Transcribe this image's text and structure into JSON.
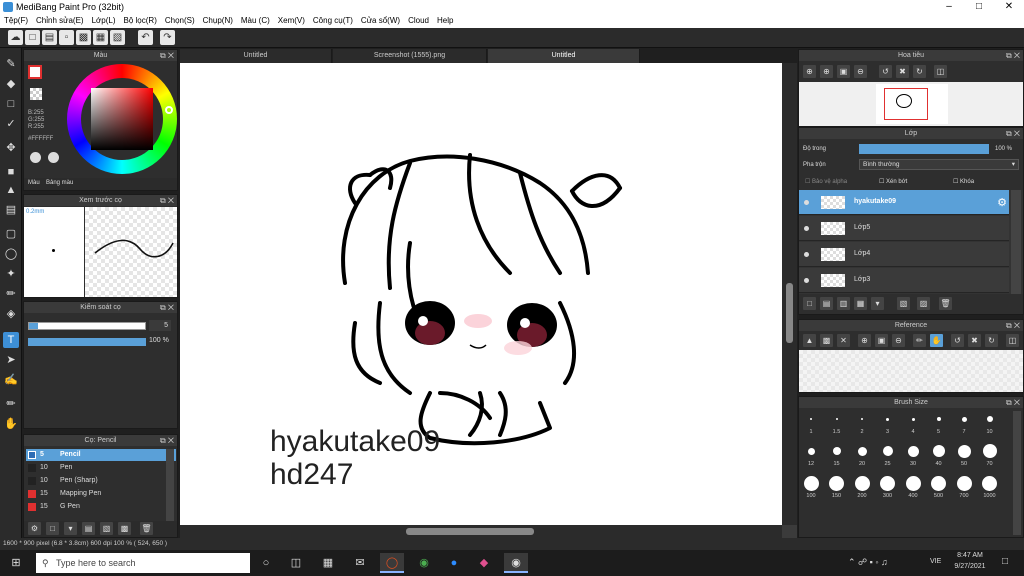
{
  "window": {
    "title": "MediBang Paint Pro (32bit)"
  },
  "menu": [
    "Tệp(F)",
    "Chỉnh sửa(E)",
    "Lớp(L)",
    "Bộ lọc(R)",
    "Chọn(S)",
    "Chụp(N)",
    "Màu (C)",
    "Xem(V)",
    "Công cụ(T)",
    "Cửa sổ(W)",
    "Cloud",
    "Help"
  ],
  "tabs": [
    "Untitled",
    "Screenshot (1555).png",
    "Untitled"
  ],
  "color_panel": {
    "title": "Màu",
    "b": "B:255",
    "g": "G:255",
    "r": "R:255",
    "hex": "#FFFFFF",
    "tab_color": "Màu",
    "tab_palette": "Bảng màu"
  },
  "brush_preview": {
    "title": "Xem trước cọ",
    "size": "0.2mm"
  },
  "brush_control": {
    "title": "Kiểm soát cọ",
    "size_value": "5",
    "opacity_value": "100 %"
  },
  "brush_list": {
    "title": "Cọ: Pencil",
    "items": [
      {
        "num": "5",
        "name": "Pencil",
        "color": "#2d6db5"
      },
      {
        "num": "10",
        "name": "Pen",
        "color": "#222"
      },
      {
        "num": "10",
        "name": "Pen (Sharp)",
        "color": "#222"
      },
      {
        "num": "15",
        "name": "Mapping Pen",
        "color": "#e03030"
      },
      {
        "num": "15",
        "name": "G Pen",
        "color": "#e03030"
      }
    ]
  },
  "navigator": {
    "title": "Hoa tiêu"
  },
  "layers": {
    "title": "Lớp",
    "opacity_label": "Độ trong",
    "opacity_value": "100 %",
    "blend_label": "Pha trộn",
    "blend_value": "Bình thường",
    "protect_alpha": "Bảo vệ alpha",
    "clipping": "Xén bớt",
    "lock": "Khóa",
    "items": [
      "hyakutake09",
      "Lớp5",
      "Lớp4",
      "Lớp3"
    ]
  },
  "reference": {
    "title": "Reference"
  },
  "brush_size": {
    "title": "Brush Size",
    "sizes": [
      "1",
      "1.5",
      "2",
      "3",
      "4",
      "5",
      "7",
      "10",
      "12",
      "15",
      "20",
      "25",
      "30",
      "40",
      "50",
      "70",
      "100",
      "150",
      "200",
      "300",
      "400",
      "500",
      "700",
      "1000"
    ]
  },
  "canvas": {
    "line1": "hyakutake09",
    "line2": "hd247"
  },
  "status": "1600 * 900 pixel   (6.8 * 3.8cm)   600 dpi   100 %   ( 524, 650 )",
  "taskbar": {
    "search": "Type here to search",
    "time": "8:47 AM",
    "date": "9/27/2021",
    "lang": "VIE"
  }
}
